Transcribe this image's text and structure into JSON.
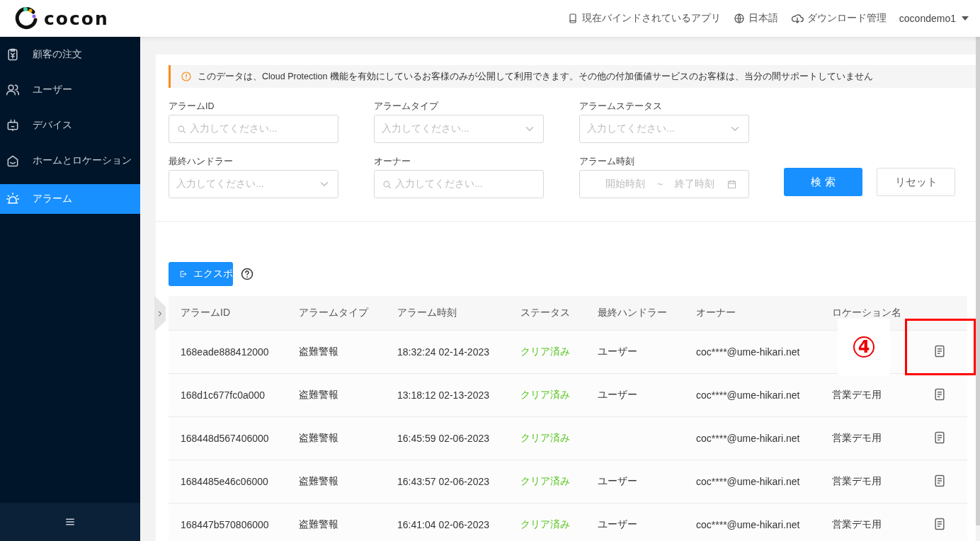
{
  "header": {
    "brand": "cocon",
    "links": [
      {
        "label": "現在バインドされているアプリ"
      },
      {
        "label": "日本語"
      },
      {
        "label": "ダウンロード管理"
      }
    ],
    "user": "cocondemo1"
  },
  "sidebar": {
    "items": [
      {
        "label": "顧客の注文",
        "selected": false
      },
      {
        "label": "ユーザー",
        "selected": false
      },
      {
        "label": "デバイス",
        "selected": false
      },
      {
        "label": "ホームとロケーション",
        "selected": false
      },
      {
        "label": "アラーム",
        "selected": true
      }
    ]
  },
  "notice": "このデータは、Cloud Protection 機能を有効にしているお客様のみが公開して利用できます。その他の付加価値サービスのお客様は、当分の間サポートしていません",
  "filters": [
    {
      "kind": "search",
      "label": "アラームID",
      "placeholder": "入力してください..."
    },
    {
      "kind": "select",
      "label": "アラームタイプ",
      "placeholder": "入力してください..."
    },
    {
      "kind": "select",
      "label": "アラームステータス",
      "placeholder": "入力してください..."
    },
    {
      "kind": "select",
      "label": "最終ハンドラー",
      "placeholder": "入力してください..."
    },
    {
      "kind": "search",
      "label": "オーナー",
      "placeholder": "入力してください..."
    },
    {
      "kind": "daterange",
      "label": "アラーム時刻",
      "start_placeholder": "開始時刻",
      "separator": "~",
      "end_placeholder": "終了時刻"
    }
  ],
  "buttons": {
    "search": "検 索",
    "reset": "リセット"
  },
  "export_button": "エクスポ",
  "table": {
    "columns": [
      "アラームID",
      "アラームタイプ",
      "アラーム時刻",
      "ステータス",
      "最終ハンドラー",
      "オーナー",
      "ロケーション名"
    ],
    "rows": [
      {
        "id": "168eade888412000",
        "type": "盗難警報",
        "time": "18:32:24 02-14-2023",
        "status": "クリア済み",
        "handler": "ユーザー",
        "owner": "coc****@ume-hikari.net"
      },
      {
        "id": "168d1c677fc0a000",
        "type": "盗難警報",
        "time": "13:18:12 02-13-2023",
        "status": "クリア済み",
        "handler": "ユーザー",
        "owner": "coc****@ume-hikari.net",
        "location": "営業デモ用"
      },
      {
        "id": "168448d567406000",
        "type": "盗難警報",
        "time": "16:45:59 02-06-2023",
        "status": "クリア済み",
        "owner": "coc****@ume-hikari.net",
        "location": "営業デモ用"
      },
      {
        "id": "1684485e46c06000",
        "type": "盗難警報",
        "time": "16:43:57 02-06-2023",
        "status": "クリア済み",
        "handler": "ユーザー",
        "owner": "coc****@ume-hikari.net",
        "location": "営業デモ用"
      },
      {
        "id": "168447b570806000",
        "type": "盗難警報",
        "time": "16:41:04 02-06-2023",
        "status": "クリア済み",
        "handler": "ユーザー",
        "owner": "coc****@ume-hikari.net",
        "location": "営業デモ用"
      }
    ]
  },
  "annotation": {
    "marker": "4"
  }
}
